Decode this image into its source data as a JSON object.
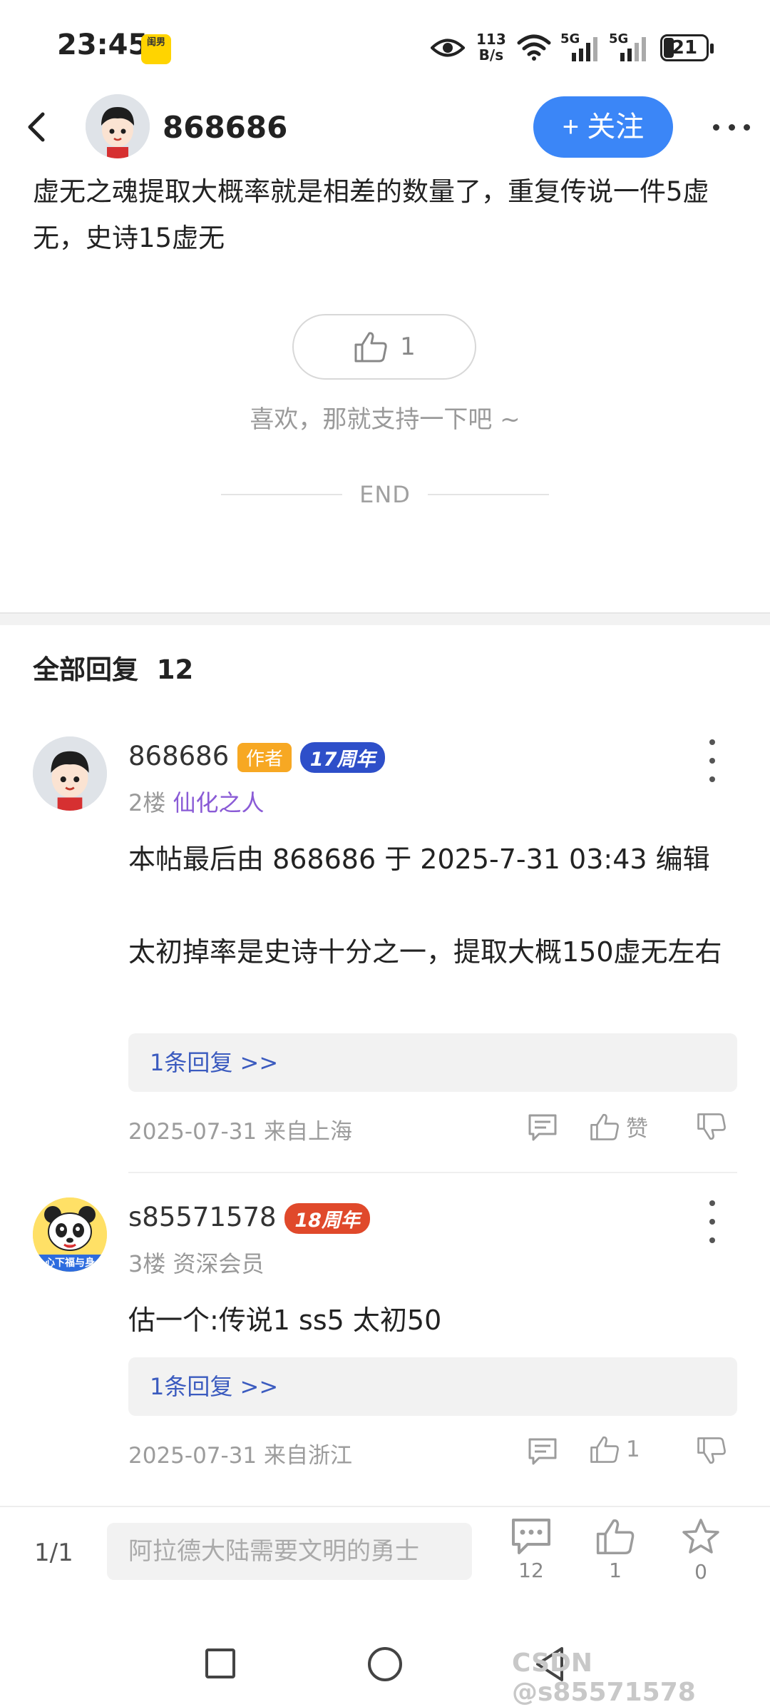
{
  "status_bar": {
    "time": "23:45",
    "mini_badge": "闺男",
    "net_speed_value": "113",
    "net_speed_unit": "B/s",
    "sig1_label": "5G",
    "sig2_label": "5G",
    "battery": "21"
  },
  "header": {
    "author_name": "868686",
    "follow_label": "+ 关注"
  },
  "post": {
    "body": "虚无之魂提取大概率就是相差的数量了，重复传说一件5虚无，史诗15虚无",
    "like_count": "1",
    "like_prompt": "喜欢，那就支持一下吧 ~",
    "end_label": "END"
  },
  "replies": {
    "heading_label": "全部回复",
    "count": "12",
    "items": [
      {
        "name": "868686",
        "author_badge": "作者",
        "anniversary_badge": "17周年",
        "floor": "2楼",
        "title": "仙化之人",
        "edit_note": "本帖最后由 868686 于 2025-7-31 03:43 编辑",
        "text": "太初掉率是史诗十分之一，提取大概150虚无左右",
        "subreply_label": "1条回复 >>",
        "date_location": "2025-07-31 来自上海",
        "like_label": "赞"
      },
      {
        "name": "s85571578",
        "anniversary_badge": "18周年",
        "floor": "3楼",
        "title": "资深会员",
        "text": "估一个:传说1 ss5 太初50",
        "avatar_caption": "心下福与身",
        "subreply_label": "1条回复 >>",
        "date_location": "2025-07-31 来自浙江",
        "like_label": "1"
      }
    ]
  },
  "bottom_bar": {
    "page_indicator": "1/1",
    "input_placeholder": "阿拉德大陆需要文明的勇士",
    "comment_count": "12",
    "like_count": "1",
    "favorite_count": "0"
  },
  "watermark": "CSDN @s85571578",
  "colors": {
    "accent_blue": "#3b86f7",
    "author_badge": "#f7a823",
    "anniv17": "#2e4fc9",
    "anniv18": "#e0492b",
    "title_purple": "#8a5bd6"
  }
}
